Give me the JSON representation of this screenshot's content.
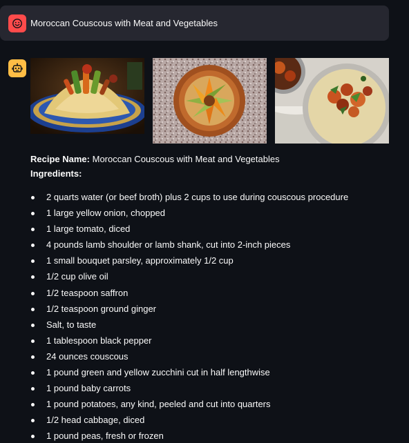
{
  "user_message": {
    "text": "Moroccan Couscous with Meat and Vegetables",
    "avatar_icon": "smiley-face-icon",
    "avatar_color": "#ff4b4b"
  },
  "assistant_message": {
    "avatar_icon": "robot-icon",
    "avatar_color": "#ffbd45",
    "recipe_name_label": "Recipe Name:",
    "recipe_name": "Moroccan Couscous with Meat and Vegetables",
    "ingredients_heading": "Ingredients:",
    "ingredients": [
      "2 quarts water (or beef broth) plus 2 cups to use during couscous procedure",
      "1 large yellow onion, chopped",
      "1 large tomato, diced",
      "4 pounds lamb shoulder or lamb shank, cut into 2-inch pieces",
      "1 small bouquet parsley, approximately 1/2 cup",
      "1/2 cup olive oil",
      "1/2 teaspoon saffron",
      "1/2 teaspoon ground ginger",
      "Salt, to taste",
      "1 tablespoon black pepper",
      "24 ounces couscous",
      "1 pound green and yellow zucchini cut in half lengthwise",
      "1 pound baby carrots",
      "1 pound potatoes, any kind, peeled and cut into quarters",
      "1/2 head cabbage, diced",
      "1 pound peas, fresh or frozen"
    ]
  },
  "colors": {
    "background": "#0e1117",
    "user_bubble": "#262730",
    "text": "#fafafa"
  }
}
